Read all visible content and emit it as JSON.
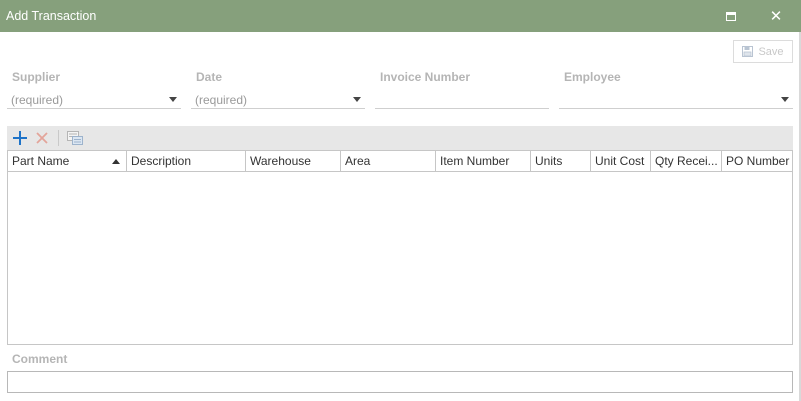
{
  "window": {
    "title": "Add Transaction",
    "maximize_icon": "maximize-icon",
    "close_icon": "close-icon"
  },
  "toolbar": {
    "save_label": "Save",
    "save_icon": "floppy-disk-icon"
  },
  "fields": {
    "supplier": {
      "label": "Supplier",
      "value": "(required)"
    },
    "date": {
      "label": "Date",
      "value": "(required)"
    },
    "invoice_number": {
      "label": "Invoice Number",
      "value": ""
    },
    "employee": {
      "label": "Employee",
      "value": ""
    }
  },
  "grid_toolbar": {
    "add_icon": "plus-icon",
    "delete_icon": "x-icon",
    "copy_icon": "copy-rows-icon"
  },
  "grid": {
    "columns": [
      {
        "label": "Part Name",
        "sorted": "ascending"
      },
      {
        "label": "Description"
      },
      {
        "label": "Warehouse"
      },
      {
        "label": "Area"
      },
      {
        "label": "Item Number"
      },
      {
        "label": "Units"
      },
      {
        "label": "Unit Cost"
      },
      {
        "label": "Qty Recei..."
      },
      {
        "label": "PO Number"
      }
    ],
    "rows": []
  },
  "comment": {
    "label": "Comment",
    "value": ""
  },
  "colors": {
    "titlebar": "#86a07c",
    "add_icon": "#1e73c8",
    "delete_icon": "#e3a49a"
  }
}
